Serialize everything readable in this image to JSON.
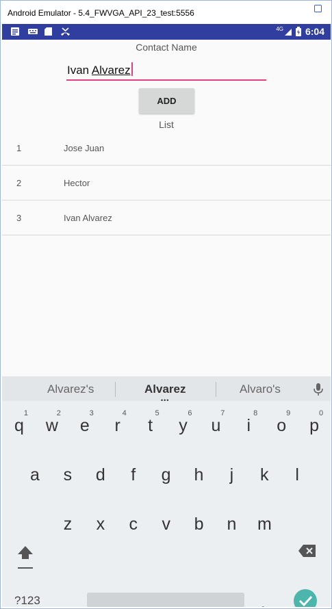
{
  "window": {
    "title": "Android Emulator - 5.4_FWVGA_API_23_test:5556"
  },
  "statusbar": {
    "network": "4G",
    "time": "6:04"
  },
  "form": {
    "contact_label": "Contact Name",
    "name_value": "Ivan Alvarez",
    "name_first": "Ivan ",
    "name_last": "Alvarez",
    "add_label": "ADD",
    "list_label": "List"
  },
  "list": {
    "rows": [
      {
        "num": "1",
        "name": "Jose Juan"
      },
      {
        "num": "2",
        "name": "Hector"
      },
      {
        "num": "3",
        "name": "Ivan Alvarez"
      }
    ]
  },
  "keyboard": {
    "suggestions": [
      "Alvarez's",
      "Alvarez",
      "Alvaro's"
    ],
    "row1": [
      {
        "k": "q",
        "h": "1"
      },
      {
        "k": "w",
        "h": "2"
      },
      {
        "k": "e",
        "h": "3"
      },
      {
        "k": "r",
        "h": "4"
      },
      {
        "k": "t",
        "h": "5"
      },
      {
        "k": "y",
        "h": "6"
      },
      {
        "k": "u",
        "h": "7"
      },
      {
        "k": "i",
        "h": "8"
      },
      {
        "k": "o",
        "h": "9"
      },
      {
        "k": "p",
        "h": "0"
      }
    ],
    "row2": [
      "a",
      "s",
      "d",
      "f",
      "g",
      "h",
      "j",
      "k",
      "l"
    ],
    "row3": [
      "z",
      "x",
      "c",
      "v",
      "b",
      "n",
      "m"
    ],
    "symbols_label": "?123",
    "comma": ",",
    "period": ".",
    "colors": {
      "accent": "#e0417e",
      "status": "#303f9f",
      "enter": "#4db6ac"
    }
  }
}
